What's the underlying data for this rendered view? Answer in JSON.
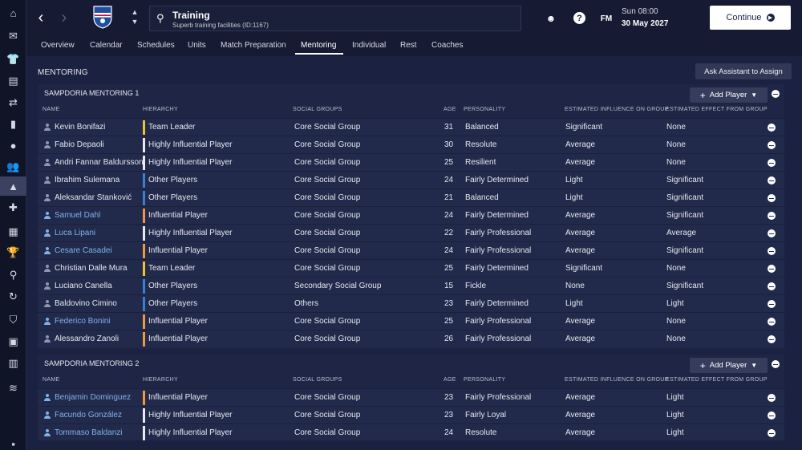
{
  "sidebar": {
    "icons": [
      "home-icon",
      "inbox-icon",
      "squad-icon",
      "tactics-icon",
      "transfers-icon",
      "report-icon",
      "ball-icon",
      "staff-icon",
      "training-icon",
      "medical-icon",
      "calendar-icon",
      "trophy-icon",
      "scouting-icon",
      "refresh-icon",
      "club-crest-icon",
      "briefcase-icon",
      "finances-icon",
      "dev-center-icon",
      "settings-icon"
    ]
  },
  "header": {
    "title": "Training",
    "subtitle": "Superb training facilities (ID:1167)",
    "fm_label": "FM",
    "date_line1": "Sun 08:00",
    "date_line2": "30 May 2027",
    "continue_label": "Continue",
    "colors": {
      "crest_blue": "#1e4fa0",
      "crest_white": "#ffffff",
      "crest_red": "#c8102e"
    }
  },
  "tabs": [
    "Overview",
    "Calendar",
    "Schedules",
    "Units",
    "Match Preparation",
    "Mentoring",
    "Individual",
    "Rest",
    "Coaches"
  ],
  "active_tab": "Mentoring",
  "page": {
    "section_title": "MENTORING",
    "assist_label": "Ask Assistant to Assign",
    "add_label": "Add Player"
  },
  "columns": {
    "name": "NAME",
    "hierarchy": "HIERARCHY",
    "social": "SOCIAL GROUPS",
    "age": "AGE",
    "personality": "PERSONALITY",
    "influence": "ESTIMATED INFLUENCE ON GROUP",
    "effect": "ESTIMATED EFFECT FROM GROUP"
  },
  "hierarchy_colors": {
    "Team Leader": "#f2c12e",
    "Highly Influential Player": "#e8e8ee",
    "Influential Player": "#f0973a",
    "Other Players": "#3a7fd0"
  },
  "groups": [
    {
      "title": "SAMPDORIA MENTORING 1",
      "rows": [
        {
          "name": "Kevin Bonifazi",
          "link": false,
          "hierarchy": "Team Leader",
          "social": "Core Social Group",
          "age": "31",
          "personality": "Balanced",
          "influence": "Significant",
          "effect": "None"
        },
        {
          "name": "Fabio Depaoli",
          "link": false,
          "hierarchy": "Highly Influential Player",
          "social": "Core Social Group",
          "age": "30",
          "personality": "Resolute",
          "influence": "Average",
          "effect": "None"
        },
        {
          "name": "Andri Fannar Baldursson",
          "link": false,
          "hierarchy": "Highly Influential Player",
          "social": "Core Social Group",
          "age": "25",
          "personality": "Resilient",
          "influence": "Average",
          "effect": "None"
        },
        {
          "name": "Ibrahim Sulemana",
          "link": false,
          "hierarchy": "Other Players",
          "social": "Core Social Group",
          "age": "24",
          "personality": "Fairly Determined",
          "influence": "Light",
          "effect": "Significant"
        },
        {
          "name": "Aleksandar Stanković",
          "link": false,
          "hierarchy": "Other Players",
          "social": "Core Social Group",
          "age": "21",
          "personality": "Balanced",
          "influence": "Light",
          "effect": "Significant"
        },
        {
          "name": "Samuel Dahl",
          "link": true,
          "hierarchy": "Influential Player",
          "social": "Core Social Group",
          "age": "24",
          "personality": "Fairly Determined",
          "influence": "Average",
          "effect": "Significant"
        },
        {
          "name": "Luca Lipani",
          "link": true,
          "hierarchy": "Highly Influential Player",
          "social": "Core Social Group",
          "age": "22",
          "personality": "Fairly Professional",
          "influence": "Average",
          "effect": "Average"
        },
        {
          "name": "Cesare Casadei",
          "link": true,
          "hierarchy": "Influential Player",
          "social": "Core Social Group",
          "age": "24",
          "personality": "Fairly Professional",
          "influence": "Average",
          "effect": "Significant"
        },
        {
          "name": "Christian Dalle Mura",
          "link": false,
          "hierarchy": "Team Leader",
          "social": "Core Social Group",
          "age": "25",
          "personality": "Fairly Determined",
          "influence": "Significant",
          "effect": "None"
        },
        {
          "name": "Luciano Canella",
          "link": false,
          "hierarchy": "Other Players",
          "social": "Secondary Social Group",
          "age": "15",
          "personality": "Fickle",
          "influence": "None",
          "effect": "Significant"
        },
        {
          "name": "Baldovino Cimino",
          "link": false,
          "hierarchy": "Other Players",
          "social": "Others",
          "age": "23",
          "personality": "Fairly Determined",
          "influence": "Light",
          "effect": "Light"
        },
        {
          "name": "Federico Bonini",
          "link": true,
          "hierarchy": "Influential Player",
          "social": "Core Social Group",
          "age": "25",
          "personality": "Fairly Professional",
          "influence": "Average",
          "effect": "None"
        },
        {
          "name": "Alessandro Zanoli",
          "link": false,
          "hierarchy": "Influential Player",
          "social": "Core Social Group",
          "age": "26",
          "personality": "Fairly Professional",
          "influence": "Average",
          "effect": "None"
        }
      ]
    },
    {
      "title": "SAMPDORIA MENTORING 2",
      "rows": [
        {
          "name": "Benjamin Dominguez",
          "link": true,
          "hierarchy": "Influential Player",
          "social": "Core Social Group",
          "age": "23",
          "personality": "Fairly Professional",
          "influence": "Average",
          "effect": "Light"
        },
        {
          "name": "Facundo González",
          "link": true,
          "hierarchy": "Highly Influential Player",
          "social": "Core Social Group",
          "age": "23",
          "personality": "Fairly Loyal",
          "influence": "Average",
          "effect": "Light"
        },
        {
          "name": "Tommaso Baldanzi",
          "link": true,
          "hierarchy": "Highly Influential Player",
          "social": "Core Social Group",
          "age": "24",
          "personality": "Resolute",
          "influence": "Average",
          "effect": "Light"
        }
      ]
    }
  ]
}
